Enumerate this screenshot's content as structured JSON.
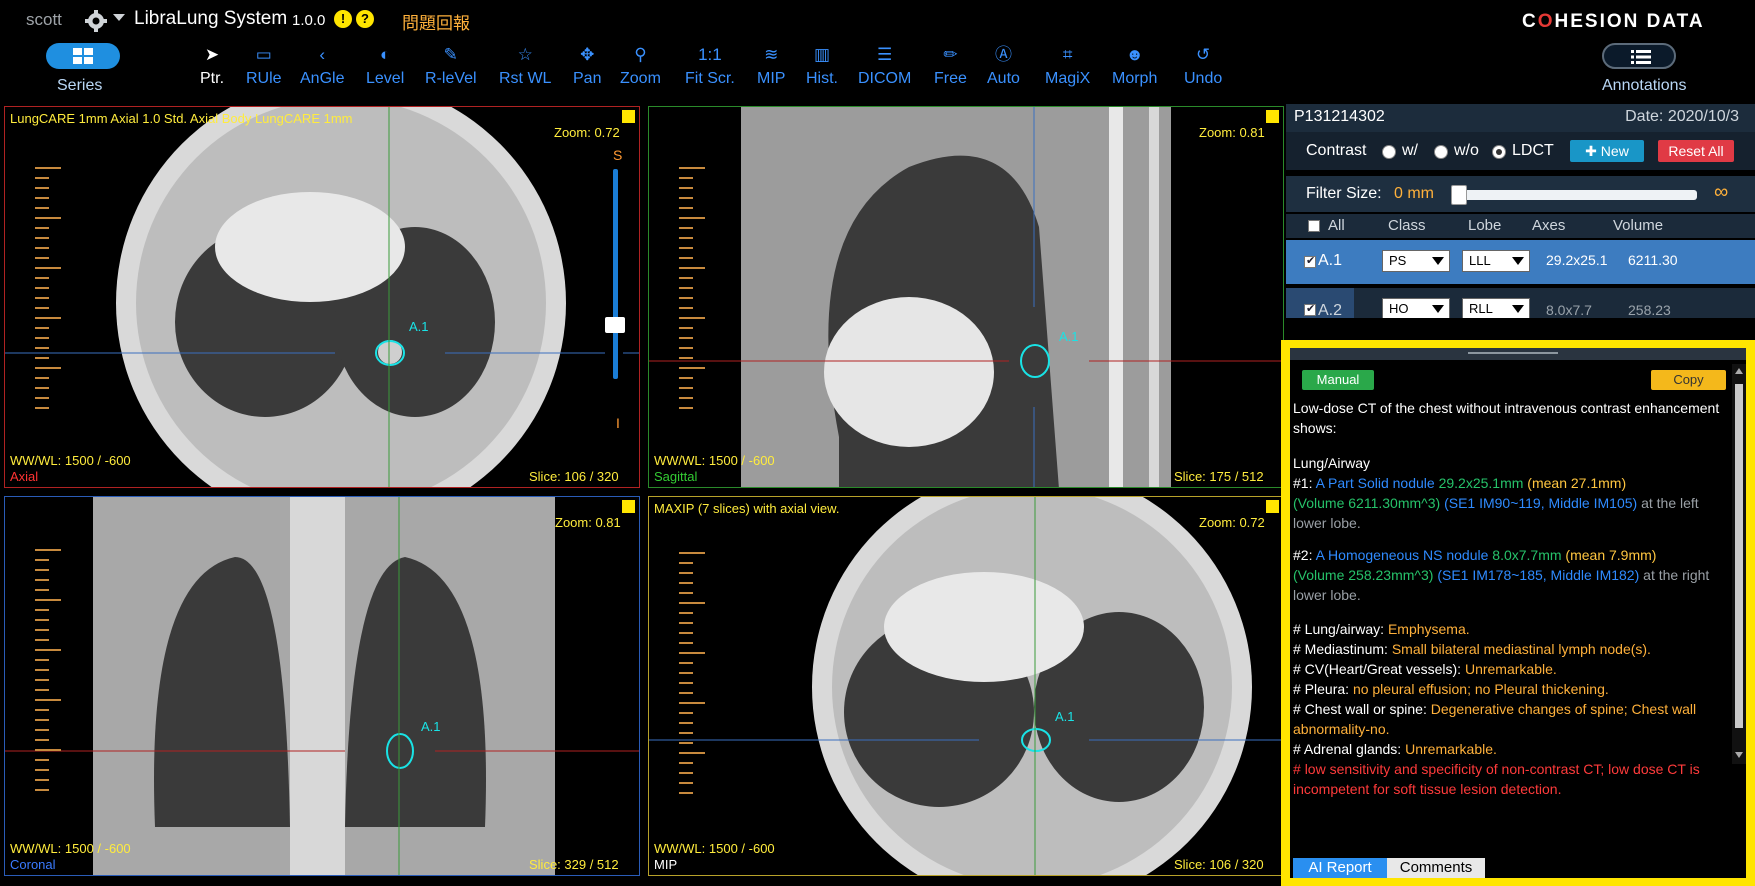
{
  "topbar": {
    "user": "scott",
    "app_title": "LibraLung System",
    "version": "1.0.0",
    "report_issue": "問題回報",
    "logo_left": "C",
    "logo_o": "O",
    "logo_right": "HESION DATA",
    "series_label": "Series",
    "annotations_label": "Annotations",
    "accent": "#1f8fe0"
  },
  "tools": [
    {
      "label": "Ptr.",
      "icon": "pointer-icon"
    },
    {
      "label": "RUle",
      "icon": "ruler-icon"
    },
    {
      "label": "AnGle",
      "icon": "angle-icon"
    },
    {
      "label": "Level",
      "icon": "contrast-icon"
    },
    {
      "label": "R-leVel",
      "icon": "eyedropper-icon"
    },
    {
      "label": "Rst WL",
      "icon": "star-icon"
    },
    {
      "label": "Pan",
      "icon": "move-icon"
    },
    {
      "label": "Zoom",
      "icon": "zoom-icon"
    },
    {
      "label": "Fit Scr.",
      "icon": "fit-icon",
      "glyph": "1:1"
    },
    {
      "label": "MIP",
      "icon": "layers-icon"
    },
    {
      "label": "Hist.",
      "icon": "histogram-icon"
    },
    {
      "label": "DICOM",
      "icon": "list-icon"
    },
    {
      "label": "Free",
      "icon": "pencil-icon"
    },
    {
      "label": "Auto",
      "icon": "auto-draw-icon"
    },
    {
      "label": "MagiX",
      "icon": "crop-icon"
    },
    {
      "label": "Morph",
      "icon": "mask-icon"
    },
    {
      "label": "Undo",
      "icon": "undo-icon"
    }
  ],
  "viewports": {
    "axial": {
      "series": "LungCARE 1mm Axial 1.0 Std. Axial Body LungCARE 1mm",
      "zoom": "Zoom: 0.72",
      "wwwl": "WW/WL: 1500 / -600",
      "view": "Axial",
      "slice": "Slice: 106 / 320",
      "nodule": "A.1",
      "top_mark": "S",
      "bottom_mark": "I",
      "border": "#b02222",
      "view_color": "#ff3333"
    },
    "sagittal": {
      "zoom": "Zoom: 0.81",
      "wwwl": "WW/WL: 1500 / -600",
      "view": "Sagittal",
      "slice": "Slice: 175 / 512",
      "nodule": "A.1",
      "border": "#2a8a2a",
      "view_color": "#33cc33"
    },
    "coronal": {
      "zoom": "Zoom: 0.81",
      "wwwl": "WW/WL: 1500 / -600",
      "view": "Coronal",
      "slice": "Slice: 329 / 512",
      "nodule": "A.1",
      "border": "#2a5cb8",
      "view_color": "#3a7bff"
    },
    "mip": {
      "series": "MAXIP (7 slices) with axial view.",
      "zoom": "Zoom: 0.72",
      "wwwl": "WW/WL: 1500 / -600",
      "view": "MIP",
      "slice": "Slice: 106 / 320",
      "nodule": "A.1",
      "border": "#b8a22a",
      "view_color": "#ffffff"
    }
  },
  "panel": {
    "patient_id": "P131214302",
    "date": "Date: 2020/10/3",
    "contrast_label": "Contrast",
    "contrast_options": [
      "w/",
      "w/o",
      "LDCT"
    ],
    "contrast_selected": "LDCT",
    "new_button": "New",
    "reset_button": "Reset All",
    "filter_label": "Filter Size:",
    "filter_value": "0 mm",
    "filter_fraction": 0,
    "filter_max": "∞",
    "columns": [
      "All",
      "Class",
      "Lobe",
      "Axes",
      "Volume"
    ],
    "rows": [
      {
        "id": "A.1",
        "class": "PS",
        "lobe": "LLL",
        "axes": "29.2x25.1",
        "volume": "6211.30",
        "selected": true
      },
      {
        "id": "A.2",
        "class": "HO",
        "lobe": "RLL",
        "axes": "8.0x7.7",
        "volume": "258.23",
        "selected": false
      }
    ]
  },
  "report": {
    "manual_button": "Manual",
    "copy_button": "Copy",
    "intro": "Low-dose CT of the chest without intravenous contrast enhancement shows:",
    "section": "Lung/Airway",
    "n1": {
      "idx": "#1:",
      "type": "A Part Solid nodule",
      "size": "29.2x25.1mm",
      "mean": "(mean 27.1mm)",
      "volume": "(Volume 6211.30mm^3)",
      "location": "(SE1 IM90~119, Middle IM105)",
      "tail1": "at",
      "tail2": "the left lower lobe."
    },
    "n2": {
      "idx": "#2:",
      "type": "A Homogeneous NS nodule",
      "size": "8.0x7.7mm",
      "mean": "(mean 7.9mm)",
      "volume": "(Volume 258.23mm^3)",
      "location": "(SE1 IM178~185, Middle IM182)",
      "tail1": "at",
      "tail2": "the right lower lobe."
    },
    "findings": [
      {
        "label": "# Lung/airway:",
        "value": "Emphysema."
      },
      {
        "label": "# Mediastinum:",
        "value": "Small bilateral mediastinal lymph node(s)."
      },
      {
        "label": "# CV(Heart/Great vessels):",
        "value": "Unremarkable."
      },
      {
        "label": "# Pleura:",
        "value": "no pleural effusion; no Pleural thickening."
      },
      {
        "label": "# Chest wall or spine:",
        "value": "Degenerative changes of spine; Chest wall abnormality-no."
      },
      {
        "label": "# Adrenal glands:",
        "value": "Unremarkable."
      }
    ],
    "warning_prefix": "#",
    "warning": "low sensitivity and specificity of non-contrast CT; low dose CT is incompetent for soft tissue lesion detection.",
    "tab_ai": "AI Report",
    "tab_comments": "Comments",
    "highlight": "#ffe500"
  }
}
